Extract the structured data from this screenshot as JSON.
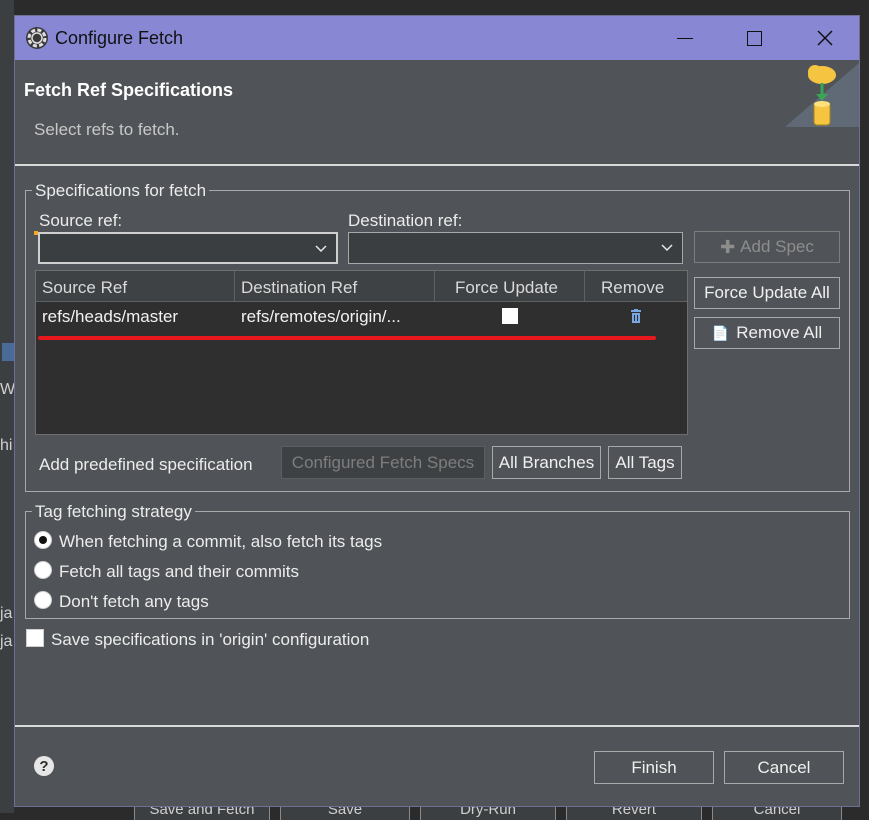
{
  "window": {
    "title": "Configure Fetch",
    "controls": [
      "minimize",
      "maximize",
      "close"
    ]
  },
  "header": {
    "title": "Fetch Ref Specifications",
    "subtitle": "Select refs to fetch."
  },
  "specs_group": {
    "legend": "Specifications for fetch",
    "source_label": "Source ref:",
    "destination_label": "Destination ref:",
    "source_value": "",
    "destination_value": "",
    "add_spec_button": "Add Spec",
    "force_update_all_button": "Force Update All",
    "remove_all_button": "Remove All",
    "table": {
      "columns": [
        "Source Ref",
        "Destination Ref",
        "Force Update",
        "Remove"
      ],
      "rows": [
        {
          "source": "refs/heads/master",
          "destination": "refs/remotes/origin/...",
          "force_update": false
        }
      ]
    },
    "predefined_label": "Add predefined specification",
    "configured_fetch_specs_button": "Configured Fetch Specs",
    "all_branches_button": "All Branches",
    "all_tags_button": "All Tags"
  },
  "tag_group": {
    "legend": "Tag fetching strategy",
    "options": [
      {
        "label": "When fetching a commit, also fetch its tags",
        "selected": true
      },
      {
        "label": "Fetch all tags and their commits",
        "selected": false
      },
      {
        "label": "Don't fetch any tags",
        "selected": false
      }
    ]
  },
  "save_spec": {
    "label": "Save specifications in 'origin' configuration",
    "checked": false
  },
  "footer": {
    "finish_button": "Finish",
    "cancel_button": "Cancel"
  },
  "background": {
    "left_fragments": [
      "W",
      "hi",
      "ja",
      "ja"
    ],
    "bottom_buttons": [
      "Save and Fetch",
      "Save",
      "Dry-Run",
      "Revert",
      "Cancel"
    ]
  },
  "colors": {
    "titlebar": "#8787d4",
    "dialog_bg": "#505357",
    "annotation_line": "#e8191e"
  }
}
